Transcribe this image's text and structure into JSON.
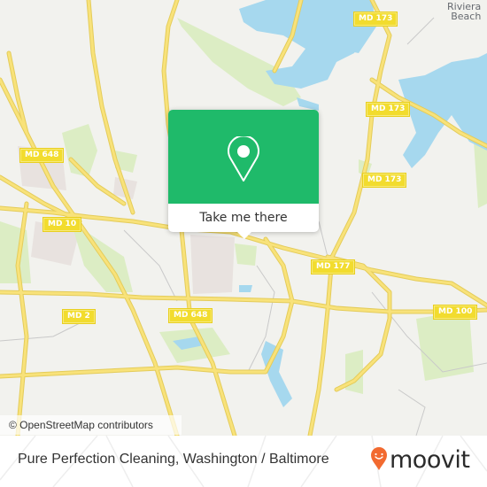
{
  "map": {
    "colors": {
      "land": "#f2f2ee",
      "water": "#a6d8ee",
      "park": "#dcedc4",
      "urban": "#e8e2df",
      "road": "#f8e27a",
      "road_casing": "#e4cc5a",
      "minor_road": "#c9c9c9"
    },
    "road_labels": [
      {
        "id": "md173-top",
        "text": "MD 173"
      },
      {
        "id": "md173-mid",
        "text": "MD 173"
      },
      {
        "id": "md173-low",
        "text": "MD 173"
      },
      {
        "id": "md648-left",
        "text": "MD 648"
      },
      {
        "id": "md10",
        "text": "MD 10"
      },
      {
        "id": "md177",
        "text": "MD 177"
      },
      {
        "id": "md2",
        "text": "MD 2"
      },
      {
        "id": "md648-low",
        "text": "MD 648"
      },
      {
        "id": "md100",
        "text": "MD 100"
      }
    ],
    "place_labels": [
      {
        "id": "riviera-beach",
        "line1": "Riviera",
        "line2": "Beach"
      }
    ],
    "attribution": "© OpenStreetMap contributors"
  },
  "popup": {
    "icon": "location-pin-icon",
    "action_label": "Take me there",
    "color": "#1fba6a"
  },
  "footer": {
    "title": "Pure Perfection Cleaning, Washington / Baltimore",
    "brand": "moovit",
    "brand_color": "#f26a30"
  }
}
